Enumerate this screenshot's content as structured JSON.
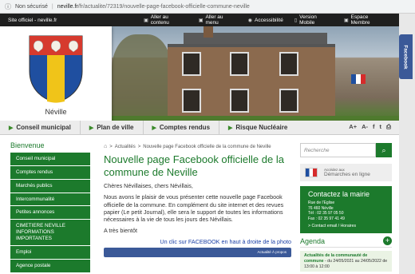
{
  "browser": {
    "security": "Non sécurisé",
    "host": "neville.fr",
    "path": "/fr/actualite/72319/nouvelle-page-facebook-officielle-commune-neville"
  },
  "topbar": {
    "site_label": "Site officiel - neville.fr",
    "links": [
      {
        "icon": "arrow-right-icon",
        "label": "Aller au contenu"
      },
      {
        "icon": "menu-icon",
        "label": "Aller au menu"
      },
      {
        "icon": "eye-icon",
        "label": "Accessibilité"
      },
      {
        "icon": "mobile-icon",
        "label": "Version Mobile"
      },
      {
        "icon": "lock-icon",
        "label": "Espace Membre"
      }
    ]
  },
  "logo": {
    "town": "Néville"
  },
  "nav": {
    "items": [
      "Conseil municipal",
      "Plan de ville",
      "Comptes rendus",
      "Risque Nucléaire"
    ],
    "tools": [
      "A+",
      "A-",
      "f",
      "t",
      "⎙"
    ]
  },
  "sidebar": {
    "heading": "Bienvenue",
    "items": [
      "Conseil municipal",
      "Comptes rendus",
      "Marchés publics",
      "Intercommunalité",
      "Petites annonces",
      "CIMETIERE NEVILLE INFORMATIONS IMPORTANTES",
      "Emploi",
      "Agence postale"
    ]
  },
  "article": {
    "breadcrumb": [
      "Actualités",
      "Nouvelle page Facebook officielle de la commune de Neville"
    ],
    "title": "Nouvelle page Facebook officielle de la commune de Neville",
    "p1": "Chères Névillaises, chers Névillais,",
    "p2": "Nous avons le plaisir de vous présenter cette nouvelle page Facebook officielle de la commune. En complément du site internet et des revues papier (Le petit Journal), elle sera le support de toutes les informations nécessaires à la vie de tous les jours des Névillais.",
    "p3": "A très bientôt",
    "fb_link": "Un clic sur FACEBOOK en haut à droite de la photo",
    "fb_strip": "Actualité   À propos"
  },
  "right": {
    "search_placeholder": "Recherche",
    "demarches_small": "Accédez aux",
    "demarches_label": "Démarches en ligne",
    "contact": {
      "heading": "Contactez la mairie",
      "lines": [
        "Rue de l'Eglise",
        "76 460 Néville",
        "Tél : 02 35 97 05 50",
        "Fax : 02 35 97 41 49"
      ],
      "link": "Contact email / Horaires"
    },
    "agenda": {
      "heading": "Agenda",
      "item_title": "Actualités de la communauté de commune",
      "item_dates": "- du 24/05/2021 au 24/05/2022 de 13:00 à 12:00"
    }
  },
  "fbtab": "Facebook",
  "colors": {
    "accent": "#1c7a2c",
    "facebook": "#3b5998"
  }
}
